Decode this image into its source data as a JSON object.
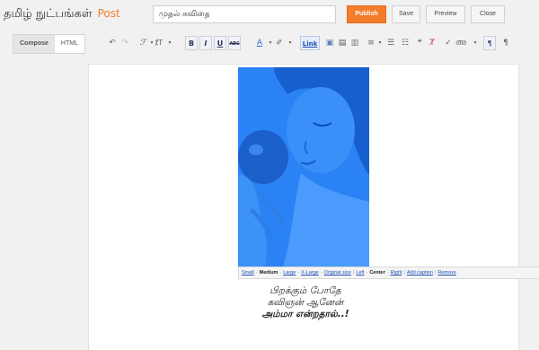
{
  "header": {
    "blog_name": "தமிழ் நுட்பங்கள்",
    "section": "Post",
    "post_title": "முதல் கவிதை",
    "publish_label": "Publish",
    "save_label": "Save",
    "preview_label": "Preview",
    "close_label": "Close"
  },
  "toolbar": {
    "compose_label": "Compose",
    "html_label": "HTML",
    "undo_icon": "undo-icon",
    "redo_icon": "redo-icon",
    "font_glyph": "ℱ",
    "size_glyph": "ⱦT",
    "bold": "B",
    "italic": "I",
    "underline": "U",
    "strike": "ABC",
    "text_color_glyph": "A",
    "link_label": "Link"
  },
  "image_toolbar": {
    "small": "Small",
    "medium": "Medium",
    "large": "Large",
    "xlarge": "X-Large",
    "original": "Original size",
    "left": "Left",
    "center": "Center",
    "right": "Right",
    "add_caption": "Add caption",
    "remove": "Remove"
  },
  "content": {
    "poem_line1": "பிறக்கும் போதே",
    "poem_line2": "கவிஞன் ஆனேன்",
    "poem_line3": "அம்மா என்றதால்..!"
  },
  "colors": {
    "publish_bg": "#f57c2a",
    "photo_tint": "#1f7bf2"
  }
}
